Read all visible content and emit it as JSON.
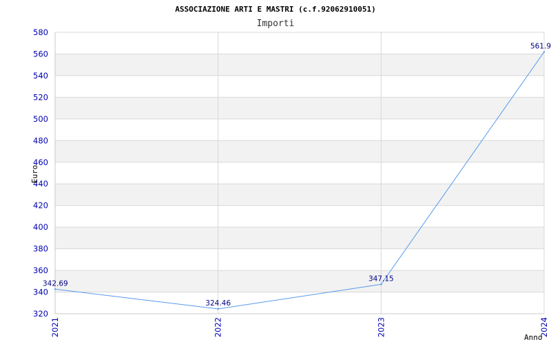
{
  "chart_data": {
    "type": "line",
    "title": "ASSOCIAZIONE ARTI E MASTRI (c.f.92062910051)",
    "subtitle": "Importi",
    "xlabel": "Anno",
    "ylabel": "Euro",
    "ylim": [
      320,
      580
    ],
    "ytick_step": 20,
    "yticks": [
      "320",
      "340",
      "360",
      "380",
      "400",
      "420",
      "440",
      "460",
      "480",
      "500",
      "520",
      "540",
      "560",
      "580"
    ],
    "categories": [
      "2021",
      "2022",
      "2023",
      "2024"
    ],
    "series": [
      {
        "values": [
          342.69,
          324.46,
          347.15,
          561.9
        ]
      }
    ],
    "data_labels": [
      "342.69",
      "324.46",
      "347.15",
      "561.9"
    ],
    "grid": true,
    "colors": {
      "line": "#5599ee",
      "band": "#f2f2f2",
      "grid": "#d8d8d8",
      "tick_text": "#0000b0"
    }
  }
}
